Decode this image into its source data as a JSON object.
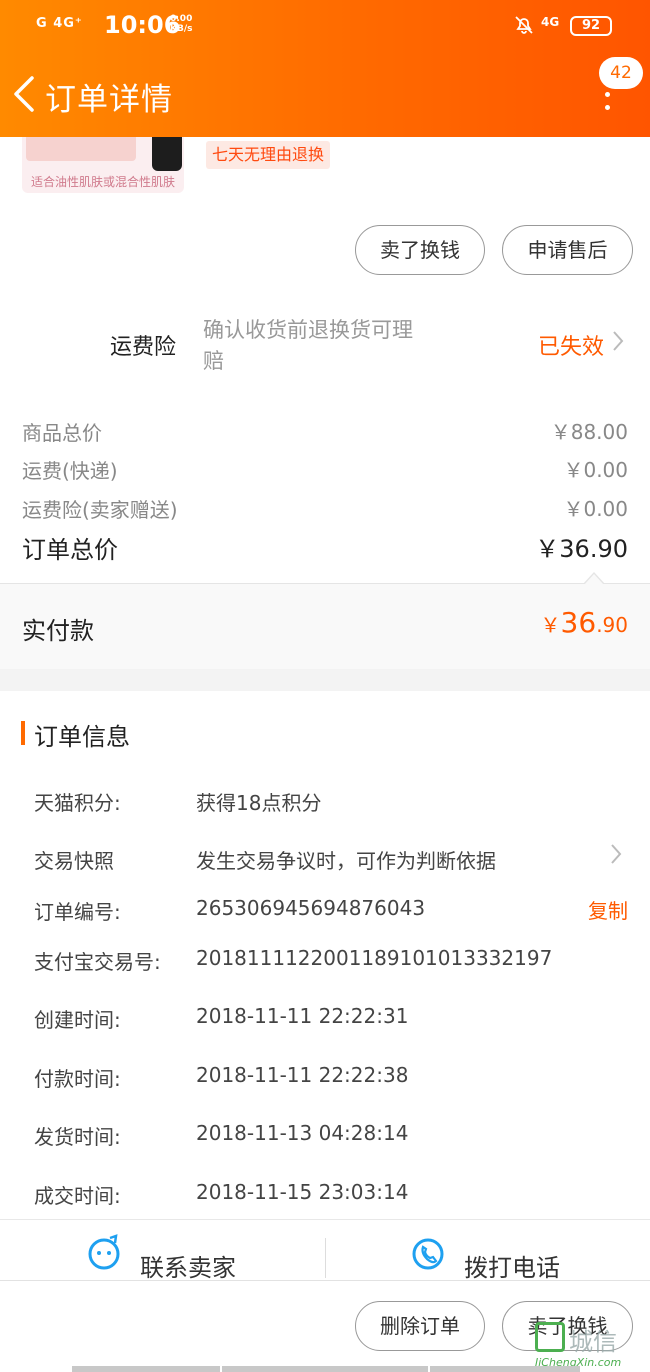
{
  "status_bar": {
    "signal": "G 4G⁺",
    "time": "10:06",
    "speed_value": "0.00",
    "speed_unit": "KB/s",
    "network": "4G",
    "battery": "92"
  },
  "header": {
    "title": "订单详情",
    "badge_count": "42"
  },
  "product": {
    "image_caption": "适合油性肌肤或混合性肌肤",
    "tag": "七天无理由退换",
    "buttons": {
      "sell": "卖了换钱",
      "after_sale": "申请售后"
    }
  },
  "freight_insurance": {
    "label": "运费险",
    "description": "确认收货前退换货可理赔",
    "status": "已失效"
  },
  "price": {
    "rows": [
      {
        "label": "商品总价",
        "value": "￥88.00"
      },
      {
        "label": "运费(快递)",
        "value": "￥0.00"
      },
      {
        "label": "运费险(卖家赠送)",
        "value": "￥0.00"
      }
    ],
    "total_label": "订单总价",
    "total_value": "￥36.90",
    "paid_label": "实付款",
    "paid_currency": "￥",
    "paid_integer": "36",
    "paid_decimal": ".90"
  },
  "order_info": {
    "heading": "订单信息",
    "rows": [
      {
        "label": "天猫积分:",
        "value": "获得18点积分"
      },
      {
        "label": "交易快照",
        "value": "发生交易争议时，可作为判断依据"
      },
      {
        "label": "订单编号:",
        "value": "265306945694876043"
      },
      {
        "label": "支付宝交易号:",
        "value": "2018111122001189101013332197"
      },
      {
        "label": "创建时间:",
        "value": "2018-11-11 22:22:31"
      },
      {
        "label": "付款时间:",
        "value": "2018-11-11 22:22:38"
      },
      {
        "label": "发货时间:",
        "value": "2018-11-13 04:28:14"
      },
      {
        "label": "成交时间:",
        "value": "2018-11-15 23:03:14"
      }
    ],
    "copy_label": "复制"
  },
  "contact": {
    "seller": "联系卖家",
    "phone": "拨打电话"
  },
  "footer": {
    "delete": "删除订单",
    "sell": "卖了换钱"
  },
  "watermark": {
    "name": "城信",
    "url": "JiChengXin.com"
  },
  "colors": {
    "accent": "#ff6a00",
    "price_accent": "#ff5a00",
    "contact_icon": "#1ea0f0"
  }
}
